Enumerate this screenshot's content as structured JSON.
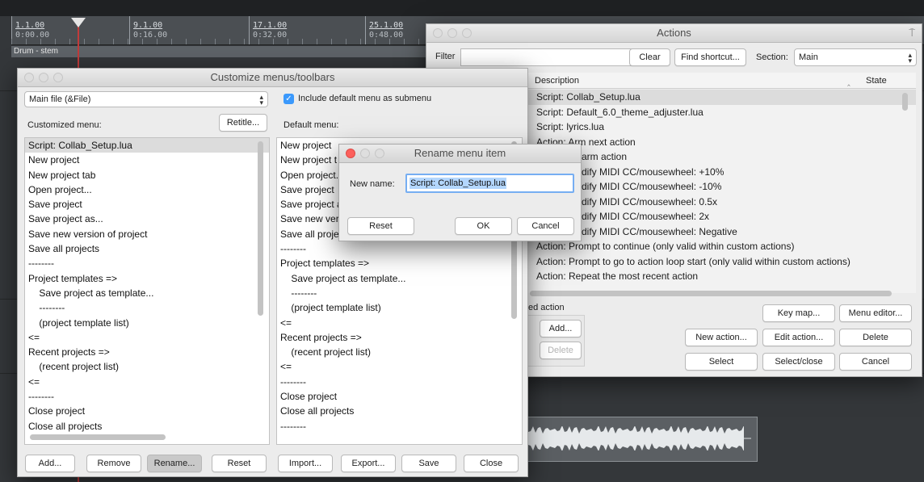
{
  "ruler": [
    {
      "bar": "1.1.00",
      "time": "0:00.00"
    },
    {
      "bar": "9.1.00",
      "time": "0:16.00"
    },
    {
      "bar": "17.1.00",
      "time": "0:32.00"
    },
    {
      "bar": "25.1.00",
      "time": "0:48.00"
    }
  ],
  "track_name": "Drum - stem",
  "customize": {
    "title": "Customize menus/toolbars",
    "menu_select": "Main file (&File)",
    "checkbox_label": "Include default menu as submenu",
    "customized_label": "Customized menu:",
    "retitle": "Retitle...",
    "default_label": "Default menu:",
    "customized_items": [
      "Script: Collab_Setup.lua",
      "New project",
      "New project tab",
      "Open project...",
      "Save project",
      "Save project as...",
      "Save new version of project",
      "Save all projects",
      "--------",
      "Project templates =>",
      "    Save project as template...",
      "    --------",
      "    (project template list)",
      "<=",
      "Recent projects =>",
      "    (recent project list)",
      "<=",
      "--------",
      "Close project",
      "Close all projects"
    ],
    "default_items": [
      "New project",
      "New project t",
      "Open project.",
      "Save project",
      "Save project a",
      "Save new ver",
      "Save all proje",
      "--------",
      "Project templates =>",
      "    Save project as template...",
      "    --------",
      "    (project template list)",
      "<=",
      "Recent projects =>",
      "    (recent project list)",
      "<=",
      "--------",
      "Close project",
      "Close all projects",
      "--------"
    ],
    "buttons": {
      "add": "Add...",
      "remove": "Remove",
      "rename": "Rename...",
      "reset": "Reset",
      "import": "Import...",
      "export": "Export...",
      "save": "Save",
      "close": "Close"
    }
  },
  "rename_dialog": {
    "title": "Rename menu item",
    "label": "New name:",
    "value": "Script: Collab_Setup.lua",
    "reset": "Reset",
    "ok": "OK",
    "cancel": "Cancel"
  },
  "actions": {
    "title": "Actions",
    "filter_label": "Filter",
    "filter_value": "",
    "clear": "Clear",
    "find_shortcut": "Find shortcut...",
    "section_label": "Section:",
    "section_value": "Main",
    "col_description": "Description",
    "col_state": "State",
    "rows": [
      "Script: Collab_Setup.lua",
      "Script: Default_6.0_theme_adjuster.lua",
      "Script: lyrics.lua",
      "Action: Arm next action",
      "arm action",
      "dify MIDI CC/mousewheel: +10%",
      "dify MIDI CC/mousewheel: -10%",
      "dify MIDI CC/mousewheel: 0.5x",
      "dify MIDI CC/mousewheel: 2x",
      "dify MIDI CC/mousewheel: Negative",
      "Action: Prompt to continue (only valid within custom actions)",
      "Action: Prompt to go to action loop start (only valid within custom actions)",
      "Action: Repeat the most recent action"
    ],
    "shortcut_label": "ed action",
    "add": "Add...",
    "delete_small": "Delete",
    "key_map": "Key map...",
    "menu_editor": "Menu editor...",
    "new_action": "New action...",
    "edit_action": "Edit action...",
    "delete": "Delete",
    "select": "Select",
    "select_close": "Select/close",
    "cancel": "Cancel"
  },
  "colors": {
    "selection": "#dcdcdc",
    "focus_blue": "#3b99fc",
    "close_red": "#fc605c",
    "playhead": "#c23b3b"
  }
}
